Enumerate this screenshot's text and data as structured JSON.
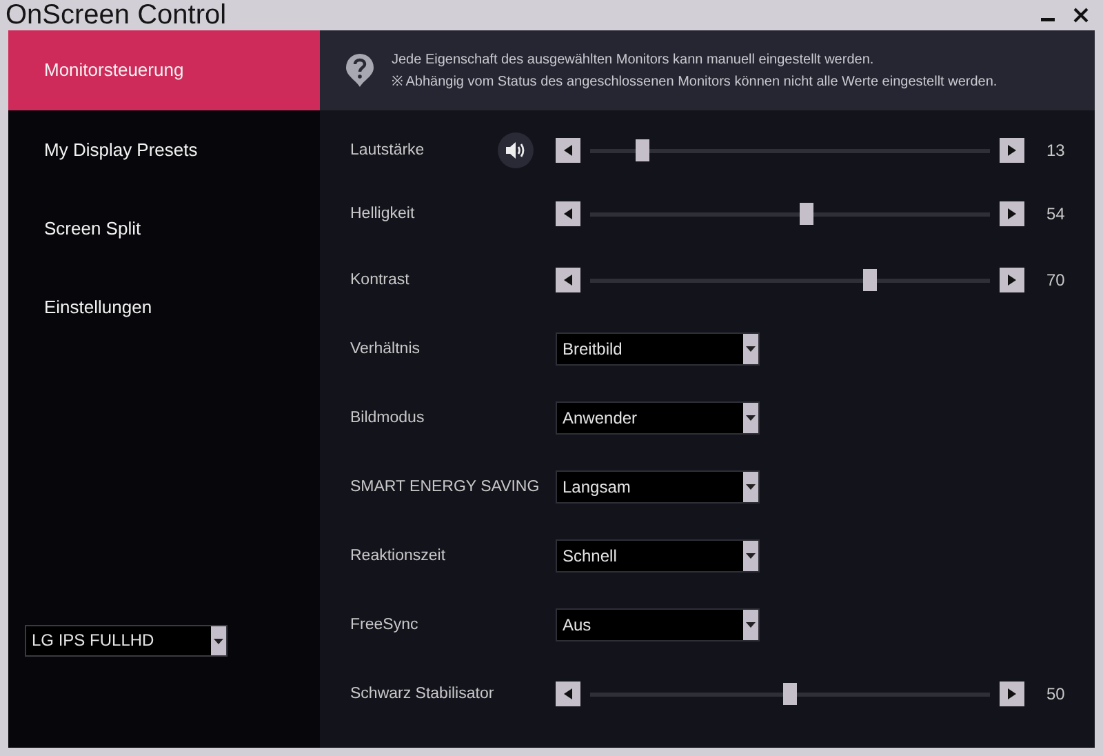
{
  "window": {
    "title": "OnScreen Control"
  },
  "sidebar": {
    "items": [
      {
        "label": "Monitorsteuerung",
        "selected": true
      },
      {
        "label": "My Display Presets",
        "selected": false
      },
      {
        "label": "Screen Split",
        "selected": false
      },
      {
        "label": "Einstellungen",
        "selected": false
      }
    ],
    "monitor_select": {
      "value": "LG IPS FULLHD"
    }
  },
  "info": {
    "lines": [
      "Jede Eigenschaft des ausgewählten Monitors kann manuell eingestellt werden.",
      "※ Abhängig vom Status des angeschlossenen Monitors können nicht alle Werte eingestellt werden."
    ]
  },
  "settings": [
    {
      "kind": "slider",
      "label": "Lautstärke",
      "speaker": true,
      "level": 0.13,
      "reading": "13"
    },
    {
      "kind": "slider",
      "label": "Helligkeit",
      "level": 0.54,
      "reading": "54"
    },
    {
      "kind": "slider",
      "label": "Kontrast",
      "level": 0.7,
      "reading": "70"
    },
    {
      "kind": "dropdown",
      "label": "Verhältnis",
      "value": "Breitbild"
    },
    {
      "kind": "dropdown",
      "label": "Bildmodus",
      "value": "Anwender"
    },
    {
      "kind": "dropdown",
      "label": "SMART ENERGY SAVING",
      "value": "Langsam"
    },
    {
      "kind": "dropdown",
      "label": "Reaktionszeit",
      "value": "Schnell"
    },
    {
      "kind": "dropdown",
      "label": "FreeSync",
      "value": "Aus"
    },
    {
      "kind": "slider",
      "label": "Schwarz Stabilisator",
      "level": 0.5,
      "reading": "50"
    }
  ]
}
